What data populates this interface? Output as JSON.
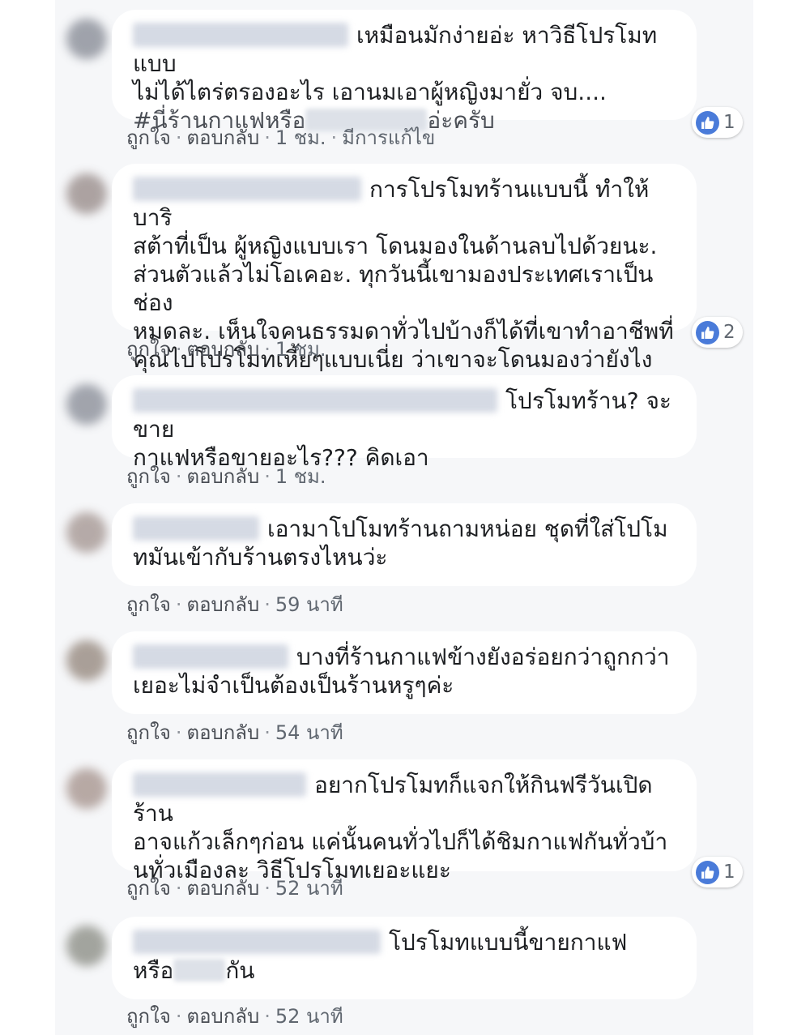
{
  "actions": {
    "like": "ถูกใจ",
    "reply": "ตอบกลับ",
    "separator": "·"
  },
  "colors": {
    "like_blue": "#4a7bd9",
    "panel_bg": "#f6f7f9",
    "bubble_bg": "#ffffff"
  },
  "icons": {
    "reaction": "like-thumb-icon"
  },
  "comments": [
    {
      "lines": [
        "เหมือนมักง่ายอ่ะ หาวิธีโปรโมทแบบ",
        "ไม่ได้ไตร่ตรองอะไร เอานมเอาผู้หญิงมายั่ว จบ....",
        "#นี่ร้านกาแฟหรือ",
        "อ่ะครับ"
      ],
      "time": "1 ชม.",
      "edited": "มีการแก้ไข",
      "likes": "1"
    },
    {
      "lines": [
        "การโปรโมทร้านแบบนี้ ทำให้ บาริ",
        "สต้าที่เป็น ผู้หญิงแบบเรา โดนมองในด้านลบไปด้วยนะ.",
        "ส่วนตัวแล้วไม่โอเคอะ. ทุกวันนี้เขามองประเทศเราเป็นช่อง",
        "หมดละ. เห็นใจคนธรรมดาทั่วไปบ้างก็ได้ที่เขาทำอาชีพที่",
        "คุณไปโปรโมทเหี้ยๆแบบเนี่ย ว่าเขาจะโดนมองว่ายังไง"
      ],
      "time": "1 ชม.",
      "likes": "2"
    },
    {
      "lines": [
        "โปรโมทร้าน? จะขาย",
        "กาแฟหรือขายอะไร??? คิดเอา"
      ],
      "time": "1 ชม."
    },
    {
      "lines": [
        "เอามาโปโมทร้านถามหน่อย ชุดที่ใส่โปโม",
        "ทมันเข้ากับร้านตรงไหนว่ะ"
      ],
      "time": "59 นาที"
    },
    {
      "lines": [
        "บางที่ร้านกาแฟข้างยังอร่อยกว่าถูกกว่า",
        "เยอะไม่จำเป็นต้องเป็นร้านหรูๆค่ะ"
      ],
      "time": "54 นาที"
    },
    {
      "lines": [
        "อยากโปรโมทก็แจกให้กินฟรีวันเปิดร้าน",
        "อาจแก้วเล็กๆก่อน แค่นั้นคนทั่วไปก็ได้ชิมกาแฟกันทั่วบ้า",
        "นทั่วเมืองละ วิธีโปรโมทเยอะแยะ"
      ],
      "time": "52 นาที",
      "likes": "1"
    },
    {
      "lines": [
        "โปรโมทแบบนี้ขายกาแฟ",
        "หรือ",
        "กัน"
      ],
      "time": "52 นาที"
    }
  ]
}
